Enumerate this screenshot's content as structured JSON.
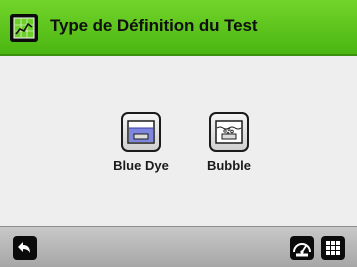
{
  "header": {
    "title": "Type de Définition du Test",
    "icon": "chart-icon"
  },
  "options": [
    {
      "label": "Blue Dye",
      "icon": "blue-dye-tank-icon"
    },
    {
      "label": "Bubble",
      "icon": "bubble-tank-icon"
    }
  ],
  "footer": {
    "back_icon": "back-arrow-icon",
    "gauge_icon": "gauge-icon",
    "menu_icon": "grid-menu-icon"
  },
  "colors": {
    "header_green": "#5cc51e",
    "content_bg": "#eeeeee",
    "footer_gray": "#b5b5b5",
    "dye_blue": "#7f86e0"
  }
}
